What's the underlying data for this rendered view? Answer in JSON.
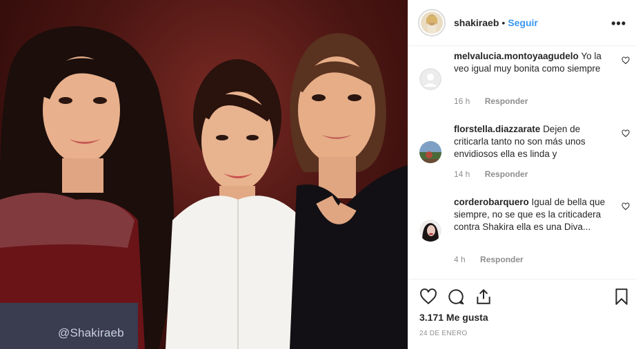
{
  "photo": {
    "watermark": "@Shakiraeb"
  },
  "header": {
    "username": "shakiraeb",
    "separator": "•",
    "follow_label": "Seguir",
    "more_icon": "more-horizontal-icon"
  },
  "comments": [
    {
      "username": "melvalucia.montoyaagudelo",
      "text": "Yo la veo igual muy bonita como siempre",
      "time": "16 h",
      "reply_label": "Responder",
      "avatar": "default-avatar"
    },
    {
      "username": "florstella.diazzarate",
      "text": "Dejen de criticarla tanto no son más unos envidiosos ella es linda y",
      "time": "14 h",
      "reply_label": "Responder",
      "avatar": "landscape-avatar"
    },
    {
      "username": "corderobarquero",
      "text": "Igual de bella que siempre, no se que es la criticadera contra Shakira ella es una Diva...",
      "time": "4 h",
      "reply_label": "Responder",
      "avatar": "portrait-avatar"
    }
  ],
  "footer": {
    "likes": "3.171 Me gusta",
    "date": "24 DE ENERO"
  },
  "colors": {
    "link": "#3897f0",
    "muted": "#8e8e8e",
    "border": "#efefef"
  }
}
